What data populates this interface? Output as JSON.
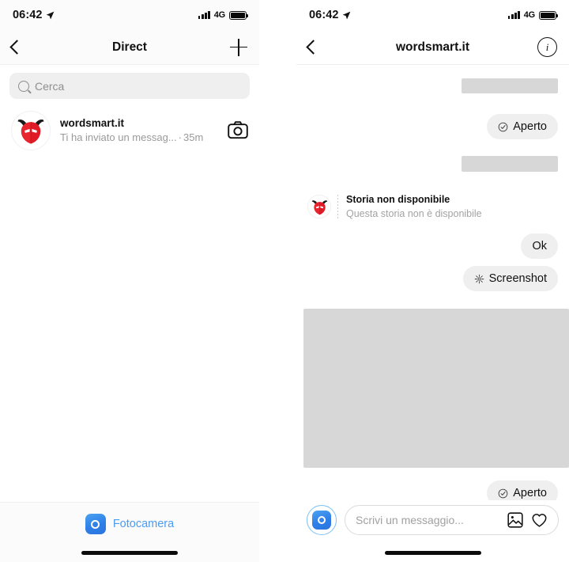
{
  "left_screen": {
    "status_bar": {
      "time": "06:42",
      "network": "4G",
      "location_icon": "location-arrow-icon",
      "signal_icon": "signal-bars-icon",
      "battery_icon": "battery-full-icon"
    },
    "nav": {
      "back_icon": "chevron-left-icon",
      "title": "Direct",
      "new_message_icon": "plus-icon"
    },
    "search": {
      "icon": "search-icon",
      "placeholder": "Cerca",
      "value": ""
    },
    "threads": [
      {
        "avatar_icon": "devil-mask-avatar",
        "name": "wordsmart.it",
        "preview": "Ti ha inviato un messag...",
        "separator": "·",
        "time": "35m",
        "action_icon": "camera-icon"
      }
    ],
    "camera_bar": {
      "icon": "camera-icon",
      "label": "Fotocamera"
    },
    "home_indicator": "home-indicator"
  },
  "right_screen": {
    "status_bar": {
      "time": "06:42",
      "network": "4G",
      "location_icon": "location-arrow-icon",
      "signal_icon": "signal-bars-icon",
      "battery_icon": "battery-full-icon"
    },
    "nav": {
      "back_icon": "chevron-left-icon",
      "title": "wordsmart.it",
      "info_icon": "info-icon",
      "info_glyph": "i"
    },
    "messages": [
      {
        "type": "placeholder_bar",
        "side": "right"
      },
      {
        "type": "status_pill",
        "side": "right",
        "icon": "check-circle-icon",
        "label": "Aperto"
      },
      {
        "type": "placeholder_bar",
        "side": "right"
      },
      {
        "type": "story_reply",
        "side": "left",
        "avatar_icon": "devil-mask-avatar",
        "title": "Storia non disponibile",
        "subtitle": "Questa storia non è disponibile"
      },
      {
        "type": "bubble",
        "side": "right",
        "label": "Ok"
      },
      {
        "type": "bubble",
        "side": "right",
        "icon": "sparkle-burst-icon",
        "label": "Screenshot"
      },
      {
        "type": "photo_placeholder",
        "side": "left"
      },
      {
        "type": "status_pill",
        "side": "right",
        "icon": "check-circle-icon",
        "label": "Aperto"
      }
    ],
    "composer": {
      "camera_icon": "camera-icon",
      "placeholder": "Scrivi un messaggio...",
      "value": "",
      "gallery_icon": "image-icon",
      "like_icon": "heart-icon"
    },
    "home_indicator": "home-indicator"
  },
  "colors": {
    "accent_blue": "#4a9cf2",
    "bubble_gray": "#efefef",
    "placeholder_gray": "#d7d7d7",
    "text_primary": "#111111",
    "text_secondary": "#8e8e8e",
    "avatar_red": "#ef3340"
  }
}
